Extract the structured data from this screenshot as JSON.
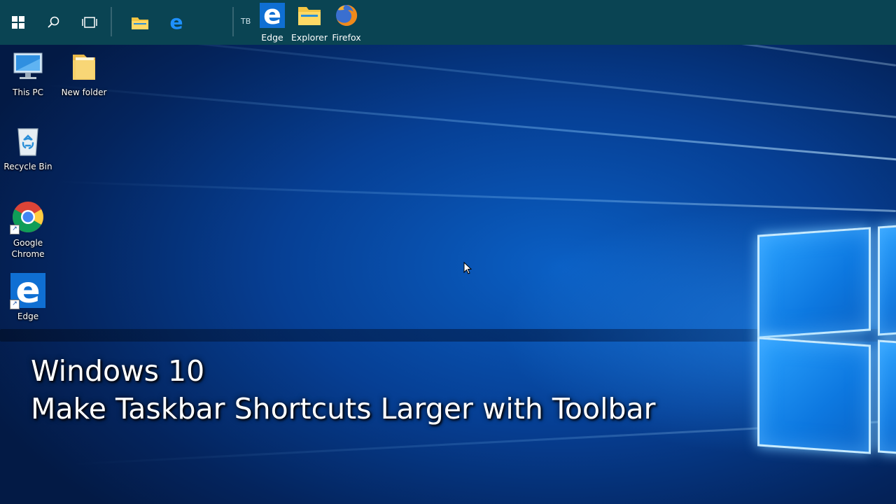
{
  "taskbar": {
    "toolbar_label": "TB",
    "toolbar_items": [
      {
        "label": "Edge",
        "icon": "edge-icon"
      },
      {
        "label": "Explorer",
        "icon": "folder-icon"
      },
      {
        "label": "Firefox",
        "icon": "firefox-icon"
      }
    ]
  },
  "desktop": {
    "icons": [
      {
        "label": "This PC",
        "icon": "computer-icon"
      },
      {
        "label": "New folder",
        "icon": "folder-icon"
      },
      {
        "label": "Recycle Bin",
        "icon": "recycle-bin-icon"
      },
      {
        "label_line1": "Google",
        "label_line2": "Chrome",
        "icon": "chrome-icon"
      },
      {
        "label": "Edge",
        "icon": "edge-icon"
      }
    ]
  },
  "overlay": {
    "line1": "Windows 10",
    "line2": "Make Taskbar Shortcuts Larger with Toolbar"
  },
  "colors": {
    "taskbar": "#0a4453",
    "accent": "#0078d7",
    "wallpaper": "#063f94"
  }
}
